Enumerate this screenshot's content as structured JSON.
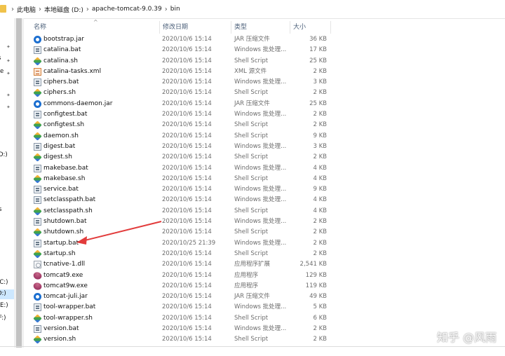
{
  "address_bar": {
    "crumbs": [
      "此电脑",
      "本地磁盘 (D:)",
      "apache-tomcat-9.0.39",
      "bin"
    ]
  },
  "nav_pane": {
    "items": [
      "s",
      "ve",
      "D:)",
      "s",
      "(C:)",
      "D:)",
      " (E:)",
      "F:)"
    ]
  },
  "columns": {
    "name": "名称",
    "date": "修改日期",
    "type": "类型",
    "size": "大小"
  },
  "files": [
    {
      "name": "bootstrap.jar",
      "date": "2020/10/6 15:14",
      "type": "JAR 压缩文件",
      "size": "36 KB",
      "icon": "jar-icon"
    },
    {
      "name": "catalina.bat",
      "date": "2020/10/6 15:14",
      "type": "Windows 批处理...",
      "size": "17 KB",
      "icon": "bat-icon"
    },
    {
      "name": "catalina.sh",
      "date": "2020/10/6 15:14",
      "type": "Shell Script",
      "size": "25 KB",
      "icon": "sh-icon"
    },
    {
      "name": "catalina-tasks.xml",
      "date": "2020/10/6 15:14",
      "type": "XML 源文件",
      "size": "2 KB",
      "icon": "xml-icon"
    },
    {
      "name": "ciphers.bat",
      "date": "2020/10/6 15:14",
      "type": "Windows 批处理...",
      "size": "3 KB",
      "icon": "bat-icon"
    },
    {
      "name": "ciphers.sh",
      "date": "2020/10/6 15:14",
      "type": "Shell Script",
      "size": "2 KB",
      "icon": "sh-icon"
    },
    {
      "name": "commons-daemon.jar",
      "date": "2020/10/6 15:14",
      "type": "JAR 压缩文件",
      "size": "25 KB",
      "icon": "jar-icon"
    },
    {
      "name": "configtest.bat",
      "date": "2020/10/6 15:14",
      "type": "Windows 批处理...",
      "size": "2 KB",
      "icon": "bat-icon"
    },
    {
      "name": "configtest.sh",
      "date": "2020/10/6 15:14",
      "type": "Shell Script",
      "size": "2 KB",
      "icon": "sh-icon"
    },
    {
      "name": "daemon.sh",
      "date": "2020/10/6 15:14",
      "type": "Shell Script",
      "size": "9 KB",
      "icon": "sh-icon"
    },
    {
      "name": "digest.bat",
      "date": "2020/10/6 15:14",
      "type": "Windows 批处理...",
      "size": "3 KB",
      "icon": "bat-icon"
    },
    {
      "name": "digest.sh",
      "date": "2020/10/6 15:14",
      "type": "Shell Script",
      "size": "2 KB",
      "icon": "sh-icon"
    },
    {
      "name": "makebase.bat",
      "date": "2020/10/6 15:14",
      "type": "Windows 批处理...",
      "size": "4 KB",
      "icon": "bat-icon"
    },
    {
      "name": "makebase.sh",
      "date": "2020/10/6 15:14",
      "type": "Shell Script",
      "size": "4 KB",
      "icon": "sh-icon"
    },
    {
      "name": "service.bat",
      "date": "2020/10/6 15:14",
      "type": "Windows 批处理...",
      "size": "9 KB",
      "icon": "bat-icon"
    },
    {
      "name": "setclasspath.bat",
      "date": "2020/10/6 15:14",
      "type": "Windows 批处理...",
      "size": "4 KB",
      "icon": "bat-icon"
    },
    {
      "name": "setclasspath.sh",
      "date": "2020/10/6 15:14",
      "type": "Shell Script",
      "size": "4 KB",
      "icon": "sh-icon"
    },
    {
      "name": "shutdown.bat",
      "date": "2020/10/6 15:14",
      "type": "Windows 批处理...",
      "size": "2 KB",
      "icon": "bat-icon"
    },
    {
      "name": "shutdown.sh",
      "date": "2020/10/6 15:14",
      "type": "Shell Script",
      "size": "2 KB",
      "icon": "sh-icon"
    },
    {
      "name": "startup.bat",
      "date": "2020/10/25 21:39",
      "type": "Windows 批处理...",
      "size": "2 KB",
      "icon": "bat-icon"
    },
    {
      "name": "startup.sh",
      "date": "2020/10/6 15:14",
      "type": "Shell Script",
      "size": "2 KB",
      "icon": "sh-icon"
    },
    {
      "name": "tcnative-1.dll",
      "date": "2020/10/6 15:14",
      "type": "应用程序扩展",
      "size": "2,541 KB",
      "icon": "dll-icon"
    },
    {
      "name": "tomcat9.exe",
      "date": "2020/10/6 15:14",
      "type": "应用程序",
      "size": "129 KB",
      "icon": "exe-icon"
    },
    {
      "name": "tomcat9w.exe",
      "date": "2020/10/6 15:14",
      "type": "应用程序",
      "size": "119 KB",
      "icon": "exe-icon"
    },
    {
      "name": "tomcat-juli.jar",
      "date": "2020/10/6 15:14",
      "type": "JAR 压缩文件",
      "size": "49 KB",
      "icon": "jar-icon"
    },
    {
      "name": "tool-wrapper.bat",
      "date": "2020/10/6 15:14",
      "type": "Windows 批处理...",
      "size": "5 KB",
      "icon": "bat-icon"
    },
    {
      "name": "tool-wrapper.sh",
      "date": "2020/10/6 15:14",
      "type": "Shell Script",
      "size": "6 KB",
      "icon": "sh-icon"
    },
    {
      "name": "version.bat",
      "date": "2020/10/6 15:14",
      "type": "Windows 批处理...",
      "size": "2 KB",
      "icon": "bat-icon"
    },
    {
      "name": "version.sh",
      "date": "2020/10/6 15:14",
      "type": "Shell Script",
      "size": "2 KB",
      "icon": "sh-icon"
    }
  ],
  "annotation": {
    "color": "#e23b3b",
    "target": "startup.bat"
  },
  "watermark": "知乎 @风雨"
}
